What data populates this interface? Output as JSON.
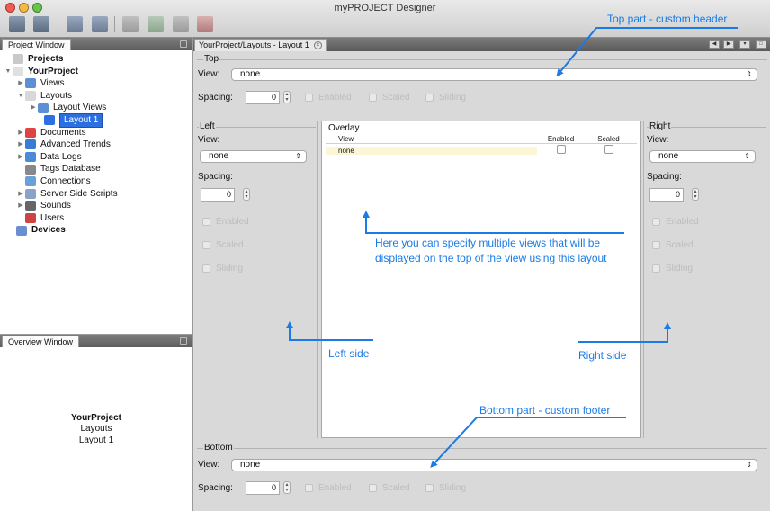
{
  "window": {
    "title": "myPROJECT Designer",
    "traffic_lights": [
      "#ef5c52",
      "#f5b944",
      "#66c44b"
    ]
  },
  "toolbar": {
    "icons": [
      "save-icon",
      "save-all-icon",
      "cut-icon",
      "copy-icon",
      "new-layout-icon",
      "add-icon",
      "duplicate-icon",
      "delete-icon"
    ]
  },
  "project_window": {
    "title": "Project Window",
    "tree": [
      {
        "label": "Projects",
        "bold": true,
        "icon": "projects-icon",
        "toggle": ""
      },
      {
        "label": "YourProject",
        "bold": true,
        "icon": "project-icon",
        "toggle": "▼"
      },
      {
        "label": "Views",
        "icon": "views-icon",
        "toggle": "▶"
      },
      {
        "label": "Layouts",
        "icon": "layouts-icon",
        "toggle": "▼"
      },
      {
        "label": "Layout Views",
        "icon": "layout-views-icon",
        "toggle": "▶"
      },
      {
        "label": "Layout 1",
        "icon": "layout-icon",
        "toggle": "",
        "selected": true
      },
      {
        "label": "Documents",
        "icon": "documents-icon",
        "toggle": "▶"
      },
      {
        "label": "Advanced Trends",
        "icon": "trends-icon",
        "toggle": "▶"
      },
      {
        "label": "Data Logs",
        "icon": "data-logs-icon",
        "toggle": "▶"
      },
      {
        "label": "Tags Database",
        "icon": "database-icon",
        "toggle": ""
      },
      {
        "label": "Connections",
        "icon": "connections-icon",
        "toggle": ""
      },
      {
        "label": "Server Side Scripts",
        "icon": "scripts-icon",
        "toggle": "▶"
      },
      {
        "label": "Sounds",
        "icon": "sound-icon",
        "toggle": "▶"
      },
      {
        "label": "Users",
        "icon": "users-icon",
        "toggle": ""
      },
      {
        "label": "Devices",
        "bold": true,
        "icon": "devices-icon",
        "toggle": ""
      }
    ]
  },
  "overview_window": {
    "title": "Overview Window",
    "project": "YourProject",
    "section": "Layouts",
    "item": "Layout 1"
  },
  "editor": {
    "tab_label": "YourProject/Layouts - Layout 1",
    "top": {
      "legend": "Top",
      "view_label": "View:",
      "view_value": "none",
      "spacing_label": "Spacing:",
      "spacing_value": "0",
      "enabled": "Enabled",
      "scaled": "Scaled",
      "sliding": "Sliding"
    },
    "left": {
      "legend": "Left",
      "view_label": "View:",
      "view_value": "none",
      "spacing_label": "Spacing:",
      "spacing_value": "0",
      "enabled": "Enabled",
      "scaled": "Scaled",
      "sliding": "Sliding"
    },
    "overlay": {
      "title": "Overlay",
      "columns": [
        "View",
        "Enabled",
        "Scaled"
      ],
      "rows": [
        {
          "view": "none"
        }
      ]
    },
    "right": {
      "legend": "Right",
      "view_label": "View:",
      "view_value": "none",
      "spacing_label": "Spacing:",
      "spacing_value": "0",
      "enabled": "Enabled",
      "scaled": "Scaled",
      "sliding": "Sliding"
    },
    "bottom": {
      "legend": "Bottom",
      "view_label": "View:",
      "view_value": "none",
      "spacing_label": "Spacing:",
      "spacing_value": "0",
      "enabled": "Enabled",
      "scaled": "Scaled",
      "sliding": "Sliding"
    }
  },
  "annotations": {
    "top": "Top part - custom header",
    "overlay_line1": "Here you can specify multiple views that will be",
    "overlay_line2": "displayed on the top of the view using this layout",
    "left": "Left side",
    "right": "Right side",
    "bottom": "Bottom part - custom footer",
    "color": "#1a7be6"
  }
}
